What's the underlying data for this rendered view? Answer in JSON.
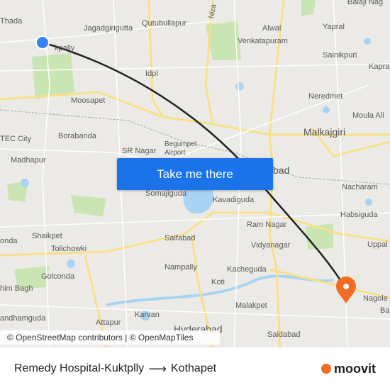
{
  "map": {
    "labels": {
      "jagadgirigutta": "Jagadgirigutta",
      "qutubullapur": "Qutubullapur",
      "alwal": "Alwal",
      "yapral": "Yapral",
      "balaji_nagar": "Balaji Nag",
      "venkatapuram": "Venkatapuram",
      "sainikpuri": "Sainikpuri",
      "kapra": "Kapra",
      "thada": "Thada",
      "kuktpally": "kpally",
      "idpl": "Idpl",
      "moosapet": "Moosapet",
      "neredmet": "Neredmet",
      "moula_ali": "Moula Ali",
      "malkajgiri": "Malkajgiri",
      "hitec_city": "TEC City",
      "borabanda": "Borabanda",
      "sr_nagar": "SR Nagar",
      "begumpet_airport": "Begumpet Airport",
      "madhapur": "Madhapur",
      "secunderabad": "bad",
      "nacharam": "Nacharam",
      "somajiguda": "Somajiguda",
      "kavadiguda": "Kavadiguda",
      "habsiguda": "Habsiguda",
      "ram_nagar": "Ram Nagar",
      "shaikpet": "Shaikpet",
      "tolichowki": "Tolichowki",
      "saifabad": "Saifabad",
      "vidyanagar": "Vidyanagar",
      "uppal": "Uppal",
      "konda": "onda",
      "nampally": "Nampally",
      "kacheguda": "Kacheguda",
      "golconda": "Golconda",
      "koti": "Koti",
      "him_bagh": "him Bagh",
      "nagole": "Nagole",
      "malakpet": "Malakpet",
      "ba": "Ba",
      "andhamguda": "andhamguda",
      "attapur": "Attapur",
      "karvan": "Karvan",
      "hyderabad": "Hyderabad",
      "saidabad": "Saidabad",
      "nizampet_rd": "Niza"
    },
    "origin_color": "#3b82f6",
    "destination_color": "#f36a21",
    "route_color": "#222222"
  },
  "cta": {
    "label": "Take me there"
  },
  "attribution": {
    "text": "© OpenStreetMap contributors | © OpenMapTiles"
  },
  "footer": {
    "origin": "Remedy Hospital-Kuktplly",
    "destination": "Kothapet",
    "brand": "moovit"
  }
}
